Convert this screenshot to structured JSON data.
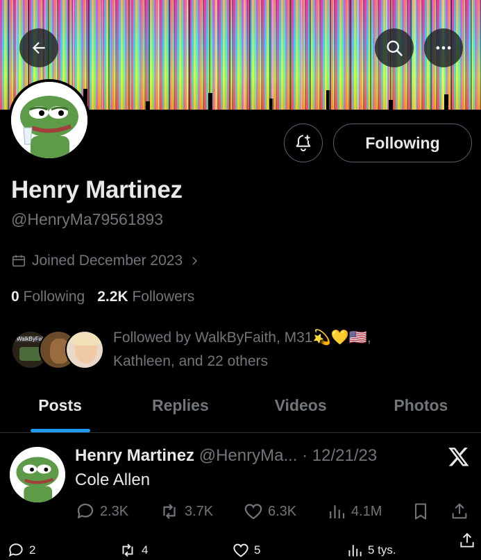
{
  "profile": {
    "name": "Henry Martinez",
    "handle": "@HenryMa79561893",
    "joined": "Joined December 2023",
    "following_count": "0",
    "following_label": "Following",
    "followers_count": "2.2K",
    "followers_label": "Followers",
    "followed_by_line1": "Followed by WalkByFaith, M31💫💛🇺🇸,",
    "followed_by_line2": "Kathleen, and 22 others",
    "followed_avatar_text": "WalkByFaith"
  },
  "header": {
    "following_button": "Following"
  },
  "tabs": [
    {
      "label": "Posts",
      "active": true
    },
    {
      "label": "Replies",
      "active": false
    },
    {
      "label": "Videos",
      "active": false
    },
    {
      "label": "Photos",
      "active": false
    }
  ],
  "post": {
    "author": "Henry Martinez",
    "handle_date": "@HenryMa... · 12/21/23",
    "text": "Cole Allen",
    "replies": "2.3K",
    "reposts": "3.7K",
    "likes": "6.3K",
    "views": "4.1M"
  },
  "bottom_bar": {
    "replies": "2",
    "reposts": "4",
    "likes": "5",
    "views": "5 tys."
  },
  "colors": {
    "accent": "#1d9bf0",
    "muted": "#71767b",
    "text": "#e7e9ea",
    "border": "#2f3336"
  }
}
